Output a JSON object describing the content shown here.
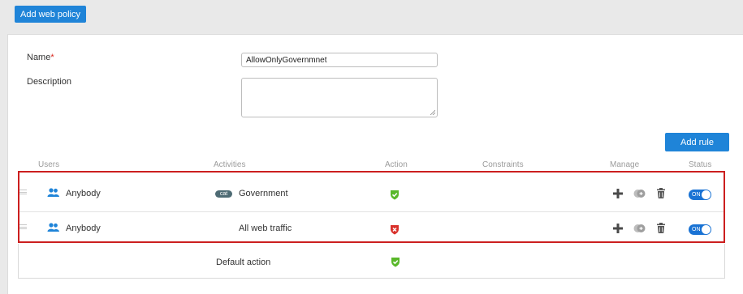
{
  "toolbar": {
    "add_web_policy_label": "Add web policy"
  },
  "form": {
    "name_label": "Name",
    "required_mark": "*",
    "name_value": "AllowOnlyGovernmnet",
    "description_label": "Description",
    "description_value": ""
  },
  "rules": {
    "add_rule_label": "Add rule",
    "columns": [
      "Users",
      "Activities",
      "Action",
      "Constraints",
      "Manage",
      "Status"
    ],
    "items": [
      {
        "user": "Anybody",
        "category_badge": "cat",
        "activity": "Government",
        "action": "allow",
        "status": "ON"
      },
      {
        "user": "Anybody",
        "category_badge": "",
        "activity": "All web traffic",
        "action": "block",
        "status": "ON"
      }
    ],
    "default_action_label": "Default action",
    "default_action": "allow"
  },
  "colors": {
    "primary_button": "#1f84d8",
    "allow_icon": "#59b82a",
    "block_icon": "#d9312b",
    "toggle_on": "#1a73d4",
    "highlight_border": "#cc1f1f"
  },
  "icons": {
    "users": "users-icon",
    "allow": "shield-check-icon",
    "block": "shield-x-icon",
    "add": "plus-icon",
    "clone": "clone-icon",
    "delete": "trash-icon",
    "drag": "drag-handle-icon"
  }
}
